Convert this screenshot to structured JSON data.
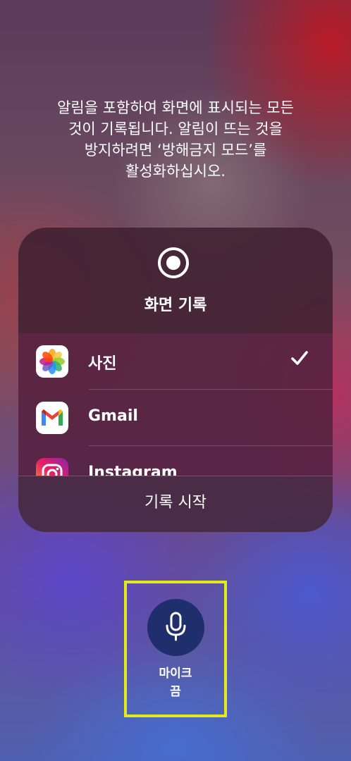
{
  "notice": {
    "text": "알림을 포함하여 화면에 표시되는 모든\n것이 기록됩니다. 알림이 뜨는 것을\n방지하려면 ‘방해금지 모드’를\n활성화하십시오."
  },
  "panel": {
    "icon": "record-icon",
    "title": "화면 기록",
    "items": [
      {
        "label": "사진",
        "icon": "photos-icon",
        "selected": true
      },
      {
        "label": "Gmail",
        "icon": "gmail-icon",
        "selected": false
      },
      {
        "label": "Instagram",
        "icon": "instagram-icon",
        "selected": false
      }
    ],
    "start_label": "기록 시작"
  },
  "mic": {
    "icon": "microphone-icon",
    "label": "마이크\n끔"
  },
  "colors": {
    "highlight": "#e3ea1a",
    "mic_button": "#1f2e6c"
  }
}
